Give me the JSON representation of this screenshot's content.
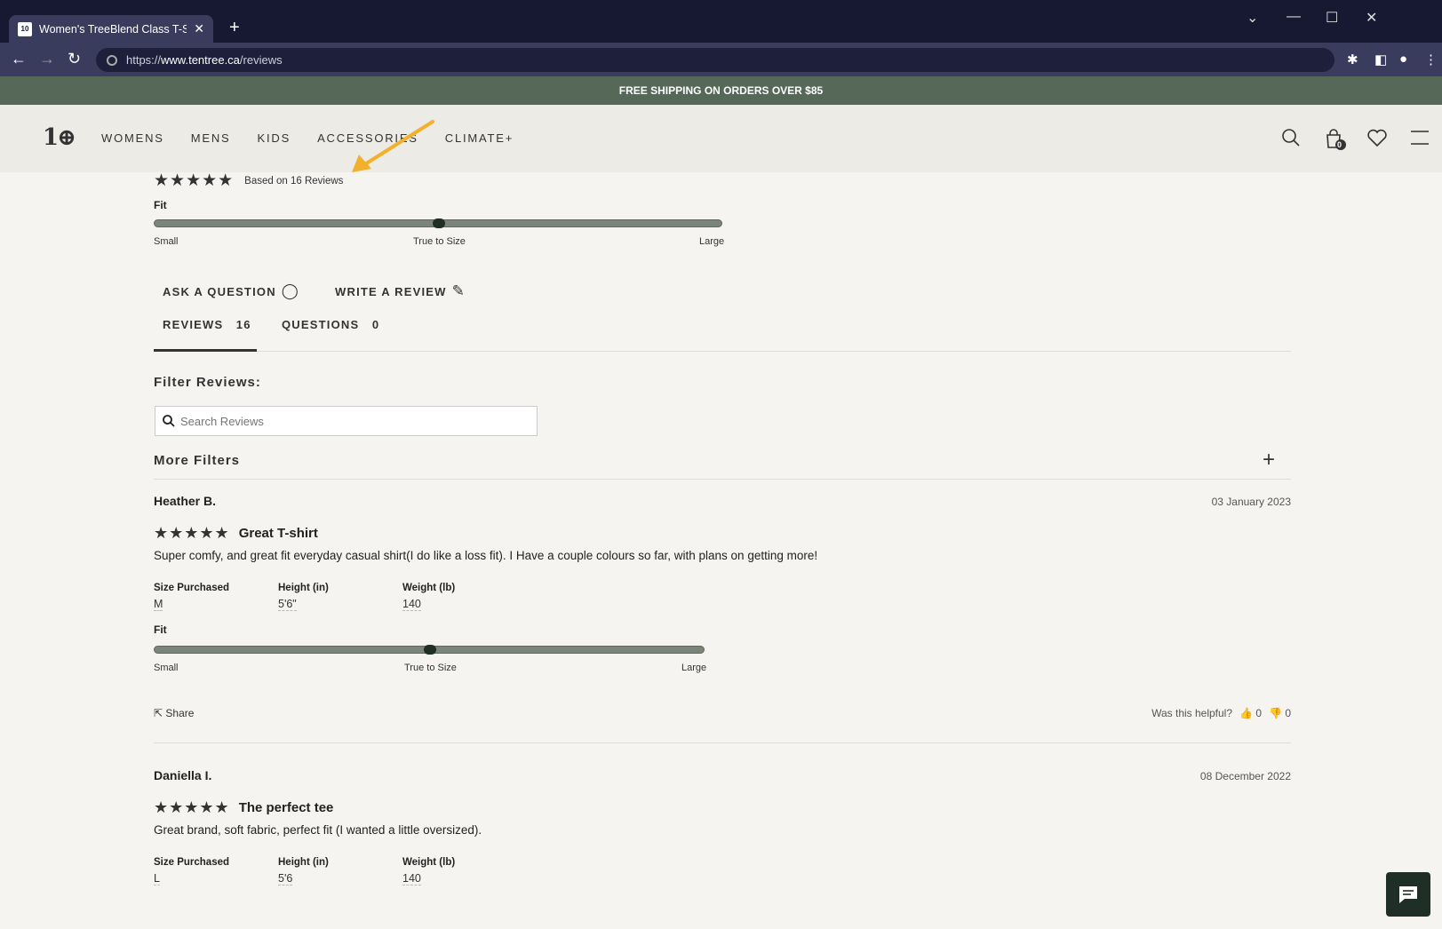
{
  "browser": {
    "tab_title": "Women's TreeBlend Class T-Shirt",
    "tab_favicon": "10",
    "url_scheme": "https://",
    "url_domain": "www.tentree.ca",
    "url_path": "/reviews"
  },
  "promo": {
    "text": "FREE SHIPPING ON ORDERS OVER $85"
  },
  "header": {
    "logo": "1⊕",
    "nav": [
      "WOMENS",
      "MENS",
      "KIDS",
      "ACCESSORIES",
      "CLIMATE+"
    ],
    "cart_count": "0"
  },
  "summary": {
    "stars": "★★★★★",
    "based_on": "Based on 16 Reviews",
    "fit_label": "Fit",
    "fit_small": "Small",
    "fit_true": "True to Size",
    "fit_large": "Large",
    "fit_value": 0.5
  },
  "actions": {
    "ask": "ASK A QUESTION",
    "write": "WRITE A REVIEW"
  },
  "tabs": {
    "reviews_label": "REVIEWS",
    "reviews_count": "16",
    "questions_label": "QUESTIONS",
    "questions_count": "0"
  },
  "filters": {
    "title": "Filter Reviews:",
    "search_placeholder": "Search Reviews",
    "more": "More Filters"
  },
  "reviews": [
    {
      "name": "Heather B.",
      "date": "03 January 2023",
      "stars": "★★★★★",
      "title": "Great T-shirt",
      "body": "Super comfy, and great fit everyday casual shirt(I do like a loss fit). I Have a couple colours so far, with plans on getting more!",
      "size_label": "Size Purchased",
      "size": "M",
      "height_label": "Height (in)",
      "height": "5'6\"",
      "weight_label": "Weight (lb)",
      "weight": "140",
      "fit_label": "Fit",
      "fit_small": "Small",
      "fit_true": "True to Size",
      "fit_large": "Large",
      "share": "Share",
      "helpful": "Was this helpful?",
      "up": "0",
      "down": "0"
    },
    {
      "name": "Daniella I.",
      "date": "08 December 2022",
      "stars": "★★★★★",
      "title": "The perfect tee",
      "body": "Great brand, soft fabric, perfect fit (I wanted a little oversized).",
      "size_label": "Size Purchased",
      "size": "L",
      "height_label": "Height (in)",
      "height": "5'6",
      "weight_label": "Weight (lb)",
      "weight": "140"
    }
  ]
}
